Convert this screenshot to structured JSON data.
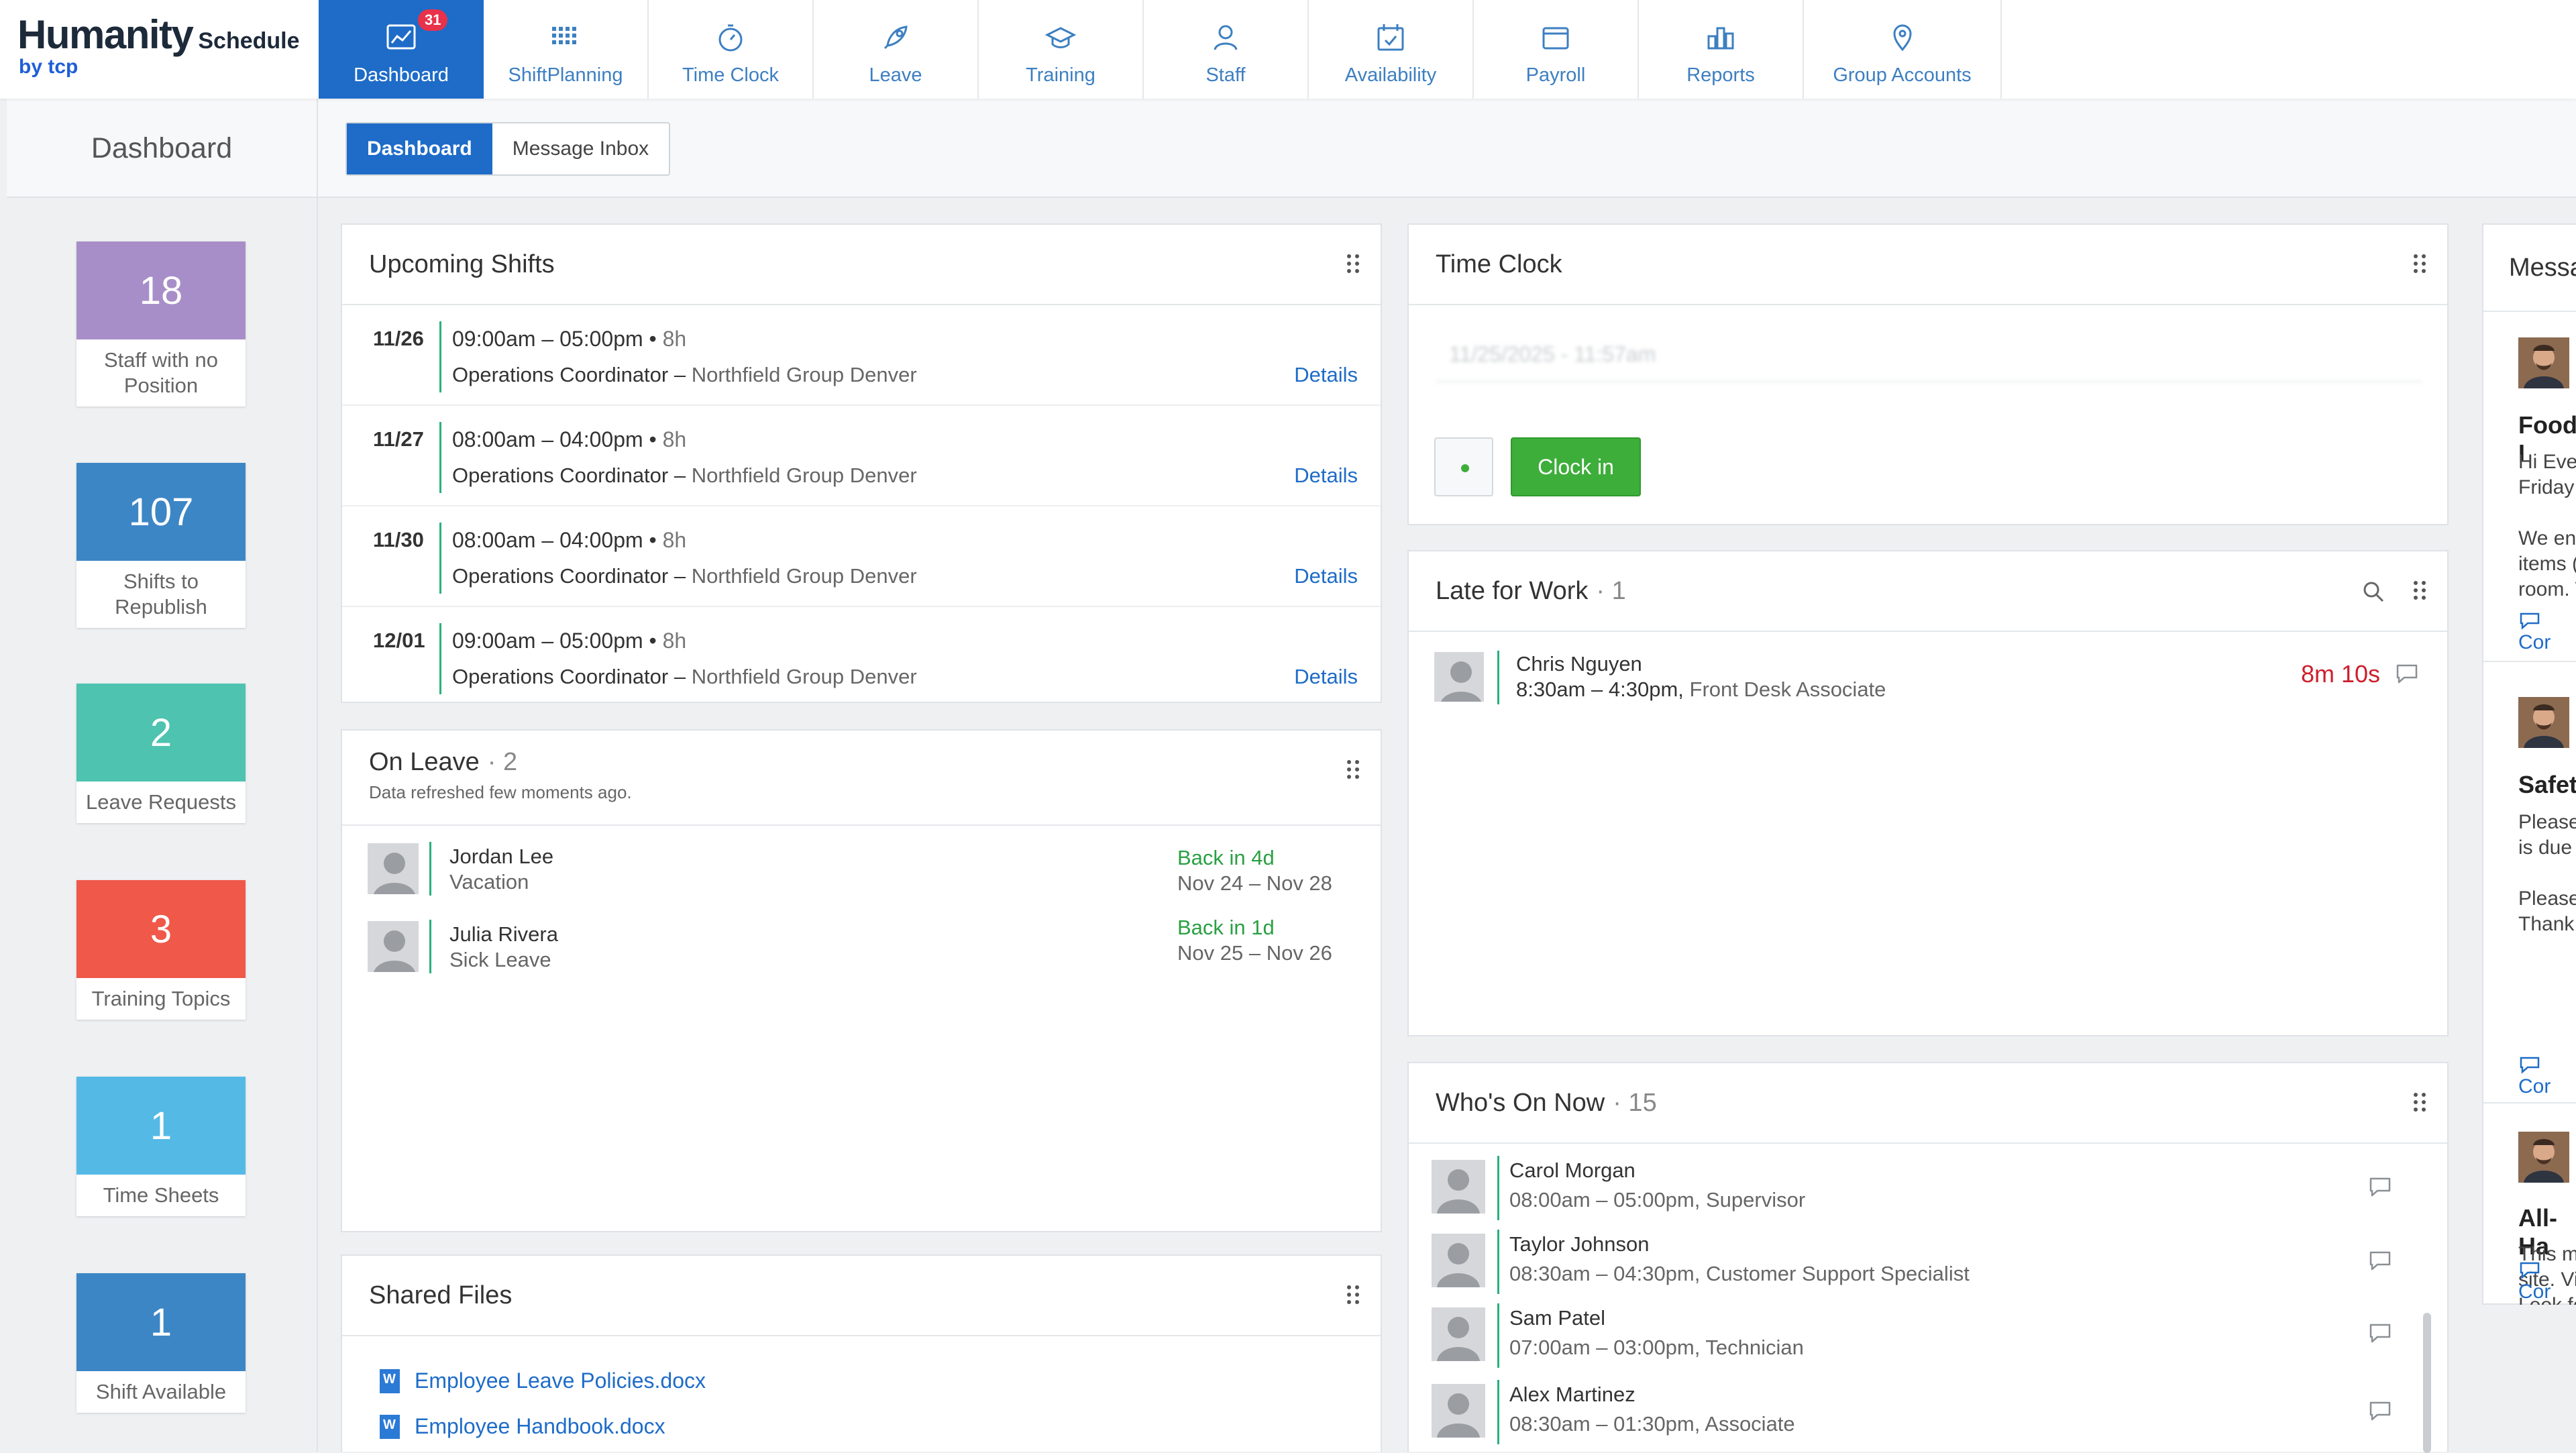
{
  "brand": {
    "name": "Humanity",
    "product": "Schedule",
    "by": "by tcp"
  },
  "nav": {
    "tabs": [
      {
        "label": "Dashboard",
        "icon": "dashboard-chart-icon",
        "badge": "31",
        "active": true
      },
      {
        "label": "ShiftPlanning",
        "icon": "grid-dots-icon"
      },
      {
        "label": "Time Clock",
        "icon": "stopwatch-icon"
      },
      {
        "label": "Leave",
        "icon": "rocket-icon"
      },
      {
        "label": "Training",
        "icon": "graduation-cap-icon"
      },
      {
        "label": "Staff",
        "icon": "person-icon"
      },
      {
        "label": "Availability",
        "icon": "calendar-check-icon"
      },
      {
        "label": "Payroll",
        "icon": "wallet-icon"
      },
      {
        "label": "Reports",
        "icon": "bar-chart-icon"
      },
      {
        "label": "Group Accounts",
        "icon": "map-pins-icon"
      }
    ]
  },
  "subheader": {
    "title": "Dashboard",
    "tabs": [
      {
        "label": "Dashboard",
        "active": true
      },
      {
        "label": "Message Inbox"
      }
    ]
  },
  "sidebar": {
    "stats": [
      {
        "value": "18",
        "label": "Staff with no Position",
        "color": "#a88ec9"
      },
      {
        "value": "107",
        "label": "Shifts to Republish",
        "color": "#3d86c6"
      },
      {
        "value": "2",
        "label": "Leave Requests",
        "color": "#4ec3b0"
      },
      {
        "value": "3",
        "label": "Training Topics",
        "color": "#f0584a"
      },
      {
        "value": "1",
        "label": "Time Sheets",
        "color": "#55b9e6"
      },
      {
        "value": "1",
        "label": "Shift Available",
        "color": "#3d86c6"
      }
    ]
  },
  "upcoming": {
    "title": "Upcoming Shifts",
    "rows": [
      {
        "date": "11/26",
        "time": "09:00am – 05:00pm",
        "dur": "8h",
        "role": "Operations Coordinator",
        "loc": "Northfield Group Denver",
        "link": "Details"
      },
      {
        "date": "11/27",
        "time": "08:00am – 04:00pm",
        "dur": "8h",
        "role": "Operations Coordinator",
        "loc": "Northfield Group Denver",
        "link": "Details"
      },
      {
        "date": "11/30",
        "time": "08:00am – 04:00pm",
        "dur": "8h",
        "role": "Operations Coordinator",
        "loc": "Northfield Group Denver",
        "link": "Details"
      },
      {
        "date": "12/01",
        "time": "09:00am – 05:00pm",
        "dur": "8h",
        "role": "Operations Coordinator",
        "loc": "Northfield Group Denver",
        "link": "Details"
      }
    ]
  },
  "on_leave": {
    "title": "On Leave",
    "count": "· 2",
    "refreshed": "Data refreshed few moments ago.",
    "rows": [
      {
        "name": "Jordan Lee",
        "type": "Vacation",
        "back": "Back in 4d",
        "range": "Nov 24 – Nov 28"
      },
      {
        "name": "Julia Rivera",
        "type": "Sick Leave",
        "back": "Back in 1d",
        "range": "Nov 25 – Nov 26"
      }
    ]
  },
  "shared_files": {
    "title": "Shared Files",
    "files": [
      "Employee Leave Policies.docx",
      "Employee Handbook.docx"
    ]
  },
  "time_clock": {
    "title": "Time Clock",
    "datetime": "11/25/2025 - 11:57am",
    "button": "Clock in"
  },
  "late": {
    "title": "Late for Work",
    "count": "· 1",
    "rows": [
      {
        "name": "Chris Nguyen",
        "time": "8:30am – 4:30pm,",
        "role": "Front Desk Associate",
        "late": "8m 10s"
      }
    ]
  },
  "whos_on": {
    "title": "Who's On Now",
    "count": "· 15",
    "rows": [
      {
        "name": "Carol Morgan",
        "detail": "08:00am – 05:00pm, Supervisor"
      },
      {
        "name": "Taylor Johnson",
        "detail": "08:30am – 04:30pm, Customer Support Specialist"
      },
      {
        "name": "Sam Patel",
        "detail": "07:00am – 03:00pm, Technician"
      },
      {
        "name": "Alex Martinez",
        "detail": "08:30am – 01:30pm, Associate"
      }
    ]
  },
  "messages": {
    "title": "Messa",
    "items": [
      {
        "title": "Food I",
        "lines": [
          "Hi Ever",
          "Friday t",
          "",
          "We end",
          "items (",
          "room. T"
        ],
        "link": "Cor"
      },
      {
        "title": "Safety",
        "lines": [
          "Please",
          "is due l",
          "",
          "Please",
          "Thank y"
        ],
        "link": "Cor"
      },
      {
        "title": "All-Ha",
        "lines": [
          "This m",
          "site. Vi",
          "Look fo"
        ],
        "link": "Cor"
      }
    ]
  }
}
